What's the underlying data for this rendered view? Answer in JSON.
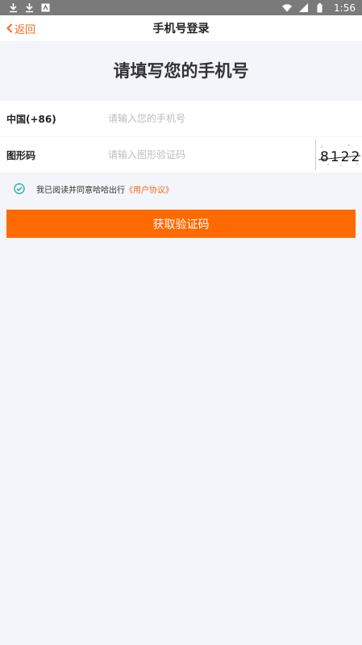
{
  "status_bar": {
    "time": "1:56",
    "icons": [
      "download-icon",
      "download-icon",
      "app-icon",
      "wifi-icon",
      "signal-icon",
      "battery-icon"
    ]
  },
  "nav": {
    "back_label": "返回",
    "title": "手机号登录"
  },
  "heading": "请填写您的手机号",
  "phone_row": {
    "label": "中国(+86)",
    "placeholder": "请输入您的手机号",
    "value": ""
  },
  "captcha_row": {
    "label": "图形码",
    "placeholder": "请输入图形验证码",
    "value": "",
    "captcha_text": "8122"
  },
  "agreement": {
    "checked": true,
    "text": "我已阅读并同意哈哈出行",
    "link": "《用户协议》"
  },
  "submit_label": "获取验证码",
  "colors": {
    "accent": "#ff6a00",
    "link": "#f26b1d",
    "check": "#2ab3a4",
    "background": "#f4f5fa"
  }
}
